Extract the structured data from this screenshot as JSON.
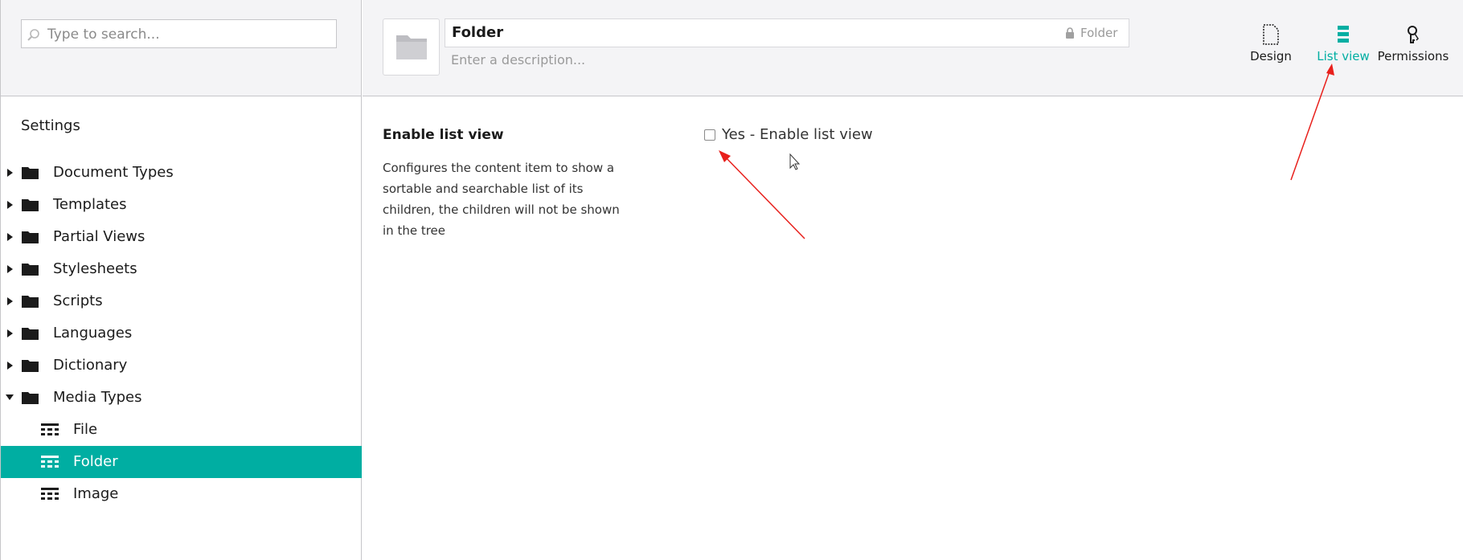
{
  "search": {
    "placeholder": "Type to search..."
  },
  "tree": {
    "title": "Settings",
    "items": [
      {
        "label": "Document Types",
        "expanded": false
      },
      {
        "label": "Templates",
        "expanded": false
      },
      {
        "label": "Partial Views",
        "expanded": false
      },
      {
        "label": "Stylesheets",
        "expanded": false
      },
      {
        "label": "Scripts",
        "expanded": false
      },
      {
        "label": "Languages",
        "expanded": false
      },
      {
        "label": "Dictionary",
        "expanded": false
      },
      {
        "label": "Media Types",
        "expanded": true
      }
    ],
    "children": [
      {
        "label": "File",
        "active": false
      },
      {
        "label": "Folder",
        "active": true
      },
      {
        "label": "Image",
        "active": false
      }
    ]
  },
  "header": {
    "name": "Folder",
    "alias": "Folder",
    "description_placeholder": "Enter a description...",
    "nav": [
      {
        "label": "Design",
        "icon": "document-icon",
        "active": false
      },
      {
        "label": "List view",
        "icon": "list-icon",
        "active": true
      },
      {
        "label": "Permissions",
        "icon": "keys-icon",
        "active": false
      }
    ]
  },
  "property": {
    "label": "Enable list view",
    "description": "Configures the content item to show a sortable and searchable list of its children, the children will not be shown in the tree",
    "checkbox_label": "Yes - Enable list view",
    "checked": false
  },
  "colors": {
    "accent": "#00aea2",
    "header_bg": "#f4f4f6",
    "annotation": "#e8201c"
  }
}
